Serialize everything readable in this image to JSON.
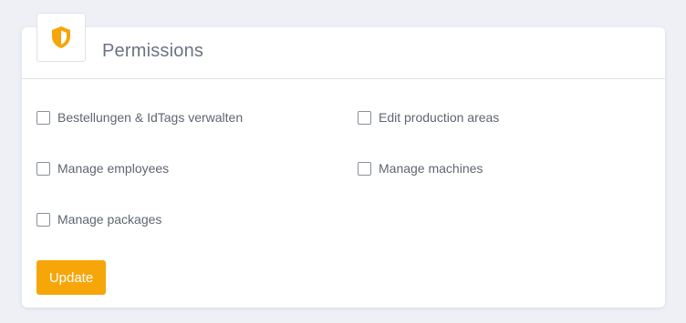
{
  "card": {
    "title": "Permissions",
    "icon": "shield-icon"
  },
  "permissions": [
    {
      "label": "Bestellungen & IdTags verwalten",
      "checked": false
    },
    {
      "label": "Edit production areas",
      "checked": false
    },
    {
      "label": "Manage employees",
      "checked": false
    },
    {
      "label": "Manage machines",
      "checked": false
    },
    {
      "label": "Manage packages",
      "checked": false
    }
  ],
  "actions": {
    "update_label": "Update"
  },
  "colors": {
    "accent": "#f6a609",
    "background": "#eef0f6",
    "text": "#5f6572"
  }
}
